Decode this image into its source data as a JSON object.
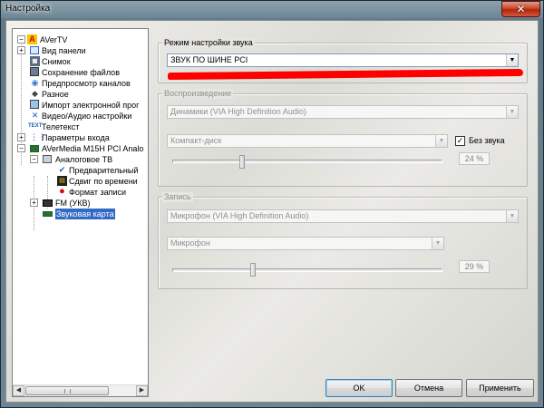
{
  "window": {
    "title": "Настройка",
    "close_glyph": "✕"
  },
  "tree": {
    "items": [
      {
        "label": "AVerTV",
        "icon": "avertv-logo-icon"
      },
      {
        "label": "Вид панели",
        "icon": "panel-view-icon"
      },
      {
        "label": "Снимок",
        "icon": "snapshot-icon"
      },
      {
        "label": "Сохранение файлов",
        "icon": "save-files-icon"
      },
      {
        "label": "Предпросмотр каналов",
        "icon": "eye-preview-icon"
      },
      {
        "label": "Разное",
        "icon": "misc-tag-icon"
      },
      {
        "label": "Импорт электронной прог",
        "icon": "epg-import-icon"
      },
      {
        "label": "Видео/Аудио настройки",
        "icon": "tools-icon"
      },
      {
        "label": "Телетекст",
        "icon": "teletext-icon"
      },
      {
        "label": "Параметры входа",
        "icon": "input-params-icon"
      },
      {
        "label": "AVerMedia M15H PCI Analo",
        "icon": "tuner-card-icon"
      },
      {
        "label": "Аналоговое ТВ",
        "icon": "tv-monitor-icon"
      },
      {
        "label": "Предварительный",
        "icon": "preview-check-icon"
      },
      {
        "label": "Сдвиг по времени",
        "icon": "timeshift-film-icon"
      },
      {
        "label": "Формат записи",
        "icon": "record-red-icon"
      },
      {
        "label": "FM (УКВ)",
        "icon": "radio-icon"
      },
      {
        "label": "Звуковая карта",
        "icon": "sound-card-icon"
      }
    ]
  },
  "audio_mode": {
    "group_label": "Режим настройки звука",
    "selected": "ЗВУК ПО ШИНЕ PCI"
  },
  "playback": {
    "group_label": "Воспроизведение",
    "device": "Динамики (VIA High Definition Audio)",
    "source": "Компакт-диск",
    "mute_label": "Без звука",
    "mute_checked": true,
    "volume_percent": 24,
    "volume_text": "24 %"
  },
  "record": {
    "group_label": "Запись",
    "device": "Микрофон (VIA High Definition Audio)",
    "source": "Микрофон",
    "level_percent": 29,
    "level_text": "29 %"
  },
  "buttons": {
    "ok": "OK",
    "cancel": "Отмена",
    "apply": "Применить"
  },
  "colors": {
    "selection": "#316ac5",
    "annotation_red": "#ff0000"
  }
}
